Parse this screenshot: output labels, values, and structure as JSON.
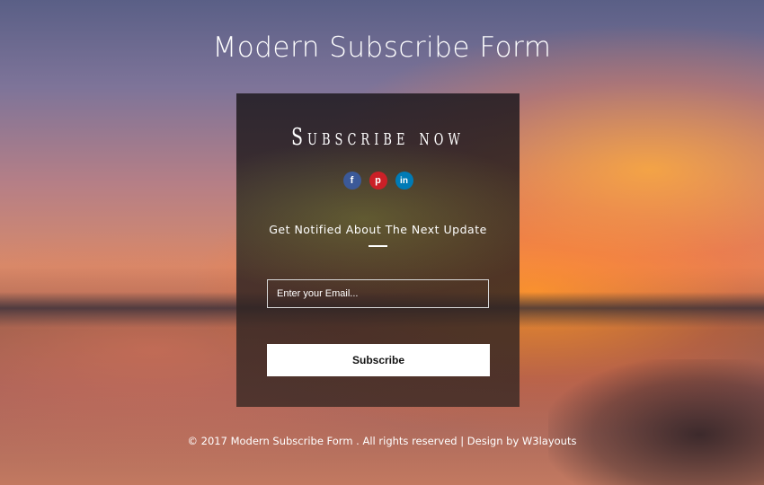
{
  "page": {
    "title": "Modern Subscribe Form"
  },
  "card": {
    "heading": "Subscribe now",
    "social": [
      {
        "name": "facebook",
        "glyph": "f",
        "color": "#3b5998"
      },
      {
        "name": "pinterest",
        "glyph": "p",
        "color": "#cb2027"
      },
      {
        "name": "linkedin",
        "glyph": "in",
        "color": "#007bb6"
      }
    ],
    "notify_text": "Get Notified About The Next Update",
    "email_placeholder": "Enter your Email...",
    "subscribe_label": "Subscribe"
  },
  "footer": {
    "text": "© 2017 Modern Subscribe Form . All rights reserved | Design by W3layouts"
  }
}
